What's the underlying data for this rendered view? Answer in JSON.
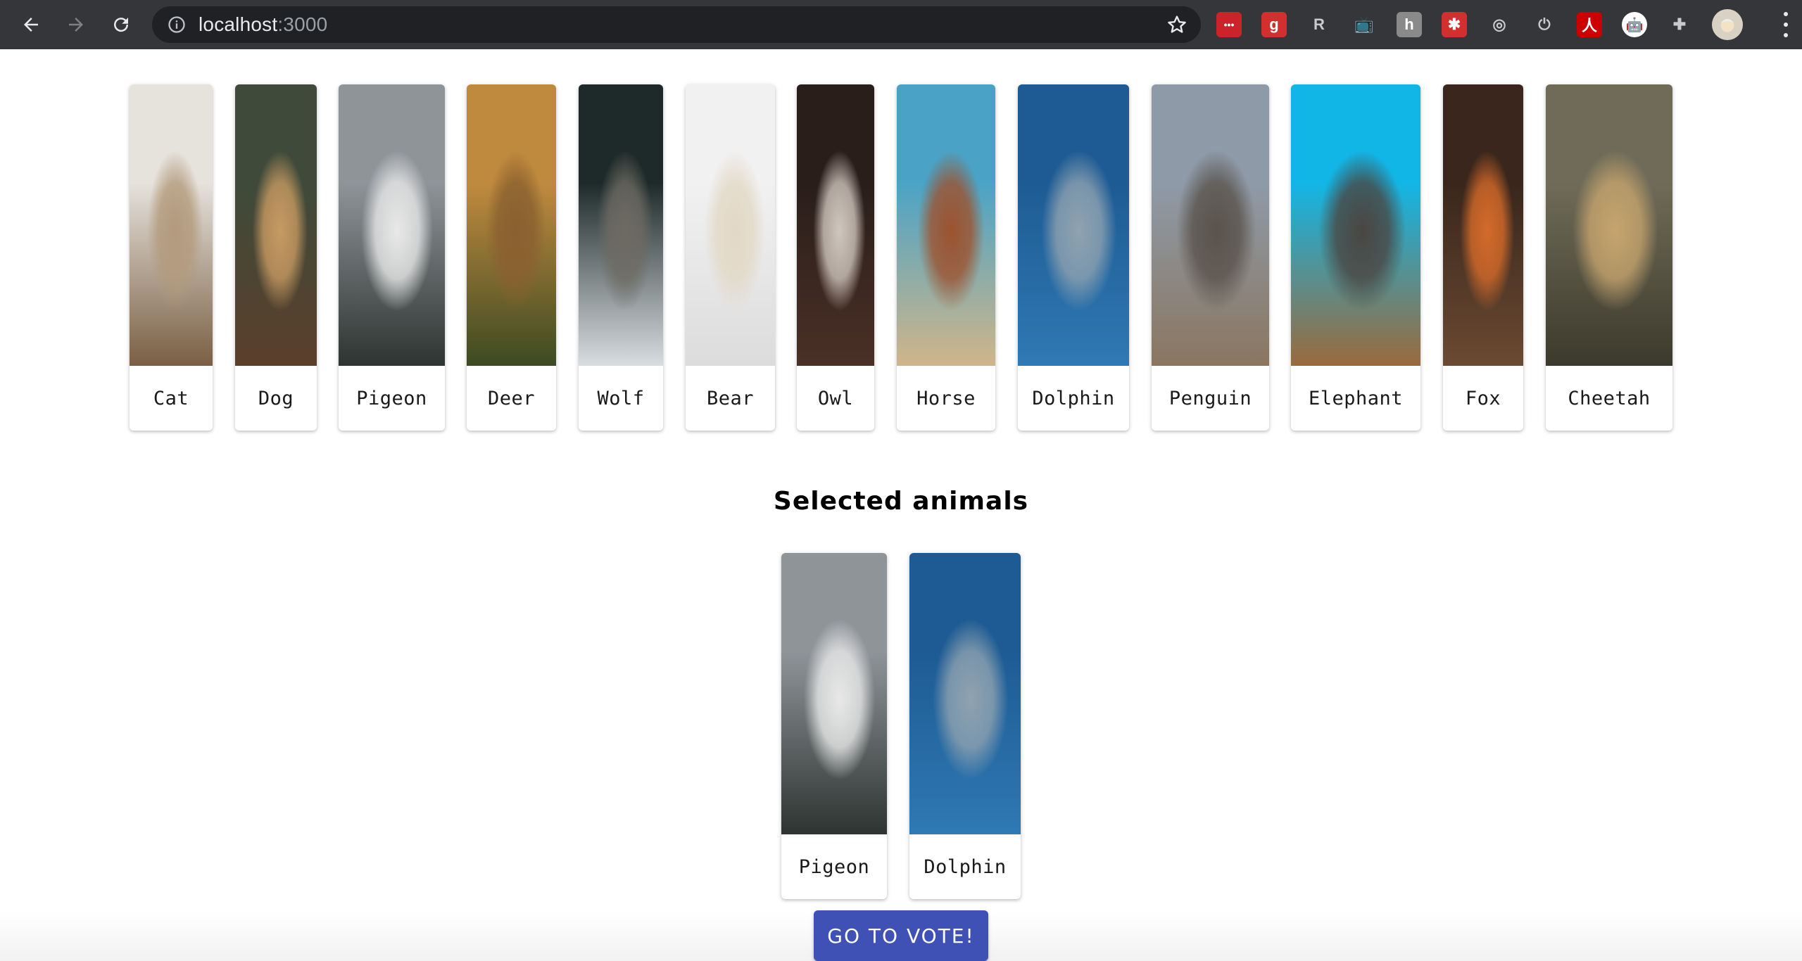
{
  "browser": {
    "url_host": "localhost",
    "url_port": ":3000"
  },
  "extensions": [
    {
      "name": "lastpass-extension-icon",
      "color": "#cc2229",
      "glyph": "•••"
    },
    {
      "name": "grammar-extension-icon",
      "color": "#d32f2f",
      "glyph": "g"
    },
    {
      "name": "r-extension-icon",
      "color": "#35363a",
      "glyph": "R"
    },
    {
      "name": "tv-extension-icon",
      "color": "#35363a",
      "glyph": "📺"
    },
    {
      "name": "h-extension-icon",
      "color": "#8a8a8a",
      "glyph": "h"
    },
    {
      "name": "bug-extension-icon",
      "color": "#d32f2f",
      "glyph": "✱"
    },
    {
      "name": "target-extension-icon",
      "color": "#35363a",
      "glyph": "◎"
    },
    {
      "name": "power-extension-icon",
      "color": "#35363a",
      "glyph": "⏻"
    },
    {
      "name": "acrobat-extension-icon",
      "color": "#cc0000",
      "glyph": "人"
    },
    {
      "name": "robot-extension-icon",
      "color": "#ffffff",
      "glyph": "🤖"
    },
    {
      "name": "puzzle-extension-icon",
      "color": "#35363a",
      "glyph": "✚"
    }
  ],
  "animals": [
    {
      "label": "Cat",
      "colors": [
        "#e6e2dc",
        "#b39a7c",
        "#7a5f44"
      ]
    },
    {
      "label": "Dog",
      "colors": [
        "#3f4a3a",
        "#c79a62",
        "#5b3f2b"
      ]
    },
    {
      "label": "Pigeon",
      "colors": [
        "#8f9499",
        "#e8e8e8",
        "#2e3431"
      ]
    },
    {
      "label": "Deer",
      "colors": [
        "#c08a3e",
        "#8a6030",
        "#3c4a22"
      ]
    },
    {
      "label": "Wolf",
      "colors": [
        "#1e2a2a",
        "#6d6a62",
        "#d8dde0"
      ]
    },
    {
      "label": "Bear",
      "colors": [
        "#f1f1f1",
        "#e2d8c6",
        "#dcdcdc"
      ]
    },
    {
      "label": "Owl",
      "colors": [
        "#2a1e1a",
        "#cfc6bd",
        "#4a3026"
      ]
    },
    {
      "label": "Horse",
      "colors": [
        "#4aa3c6",
        "#9c5330",
        "#d0b58a"
      ]
    },
    {
      "label": "Dolphin",
      "colors": [
        "#1e5b94",
        "#8fa2b0",
        "#2f79b4"
      ]
    },
    {
      "label": "Penguin",
      "colors": [
        "#8e9aa8",
        "#5a534c",
        "#8a7660"
      ]
    },
    {
      "label": "Elephant",
      "colors": [
        "#12b6e6",
        "#4a4642",
        "#9a6a3c"
      ]
    },
    {
      "label": "Fox",
      "colors": [
        "#3a261c",
        "#d46a2a",
        "#6a4a32"
      ]
    },
    {
      "label": "Cheetah",
      "colors": [
        "#6f6b58",
        "#c6a46e",
        "#3c3a2c"
      ]
    }
  ],
  "selected_title": "Selected animals",
  "selected": [
    {
      "label": "Pigeon",
      "colors": [
        "#8f9499",
        "#e8e8e8",
        "#2e3431"
      ]
    },
    {
      "label": "Dolphin",
      "colors": [
        "#1e5b94",
        "#8fa2b0",
        "#2f79b4"
      ]
    }
  ],
  "vote_button": "GO TO VOTE!"
}
